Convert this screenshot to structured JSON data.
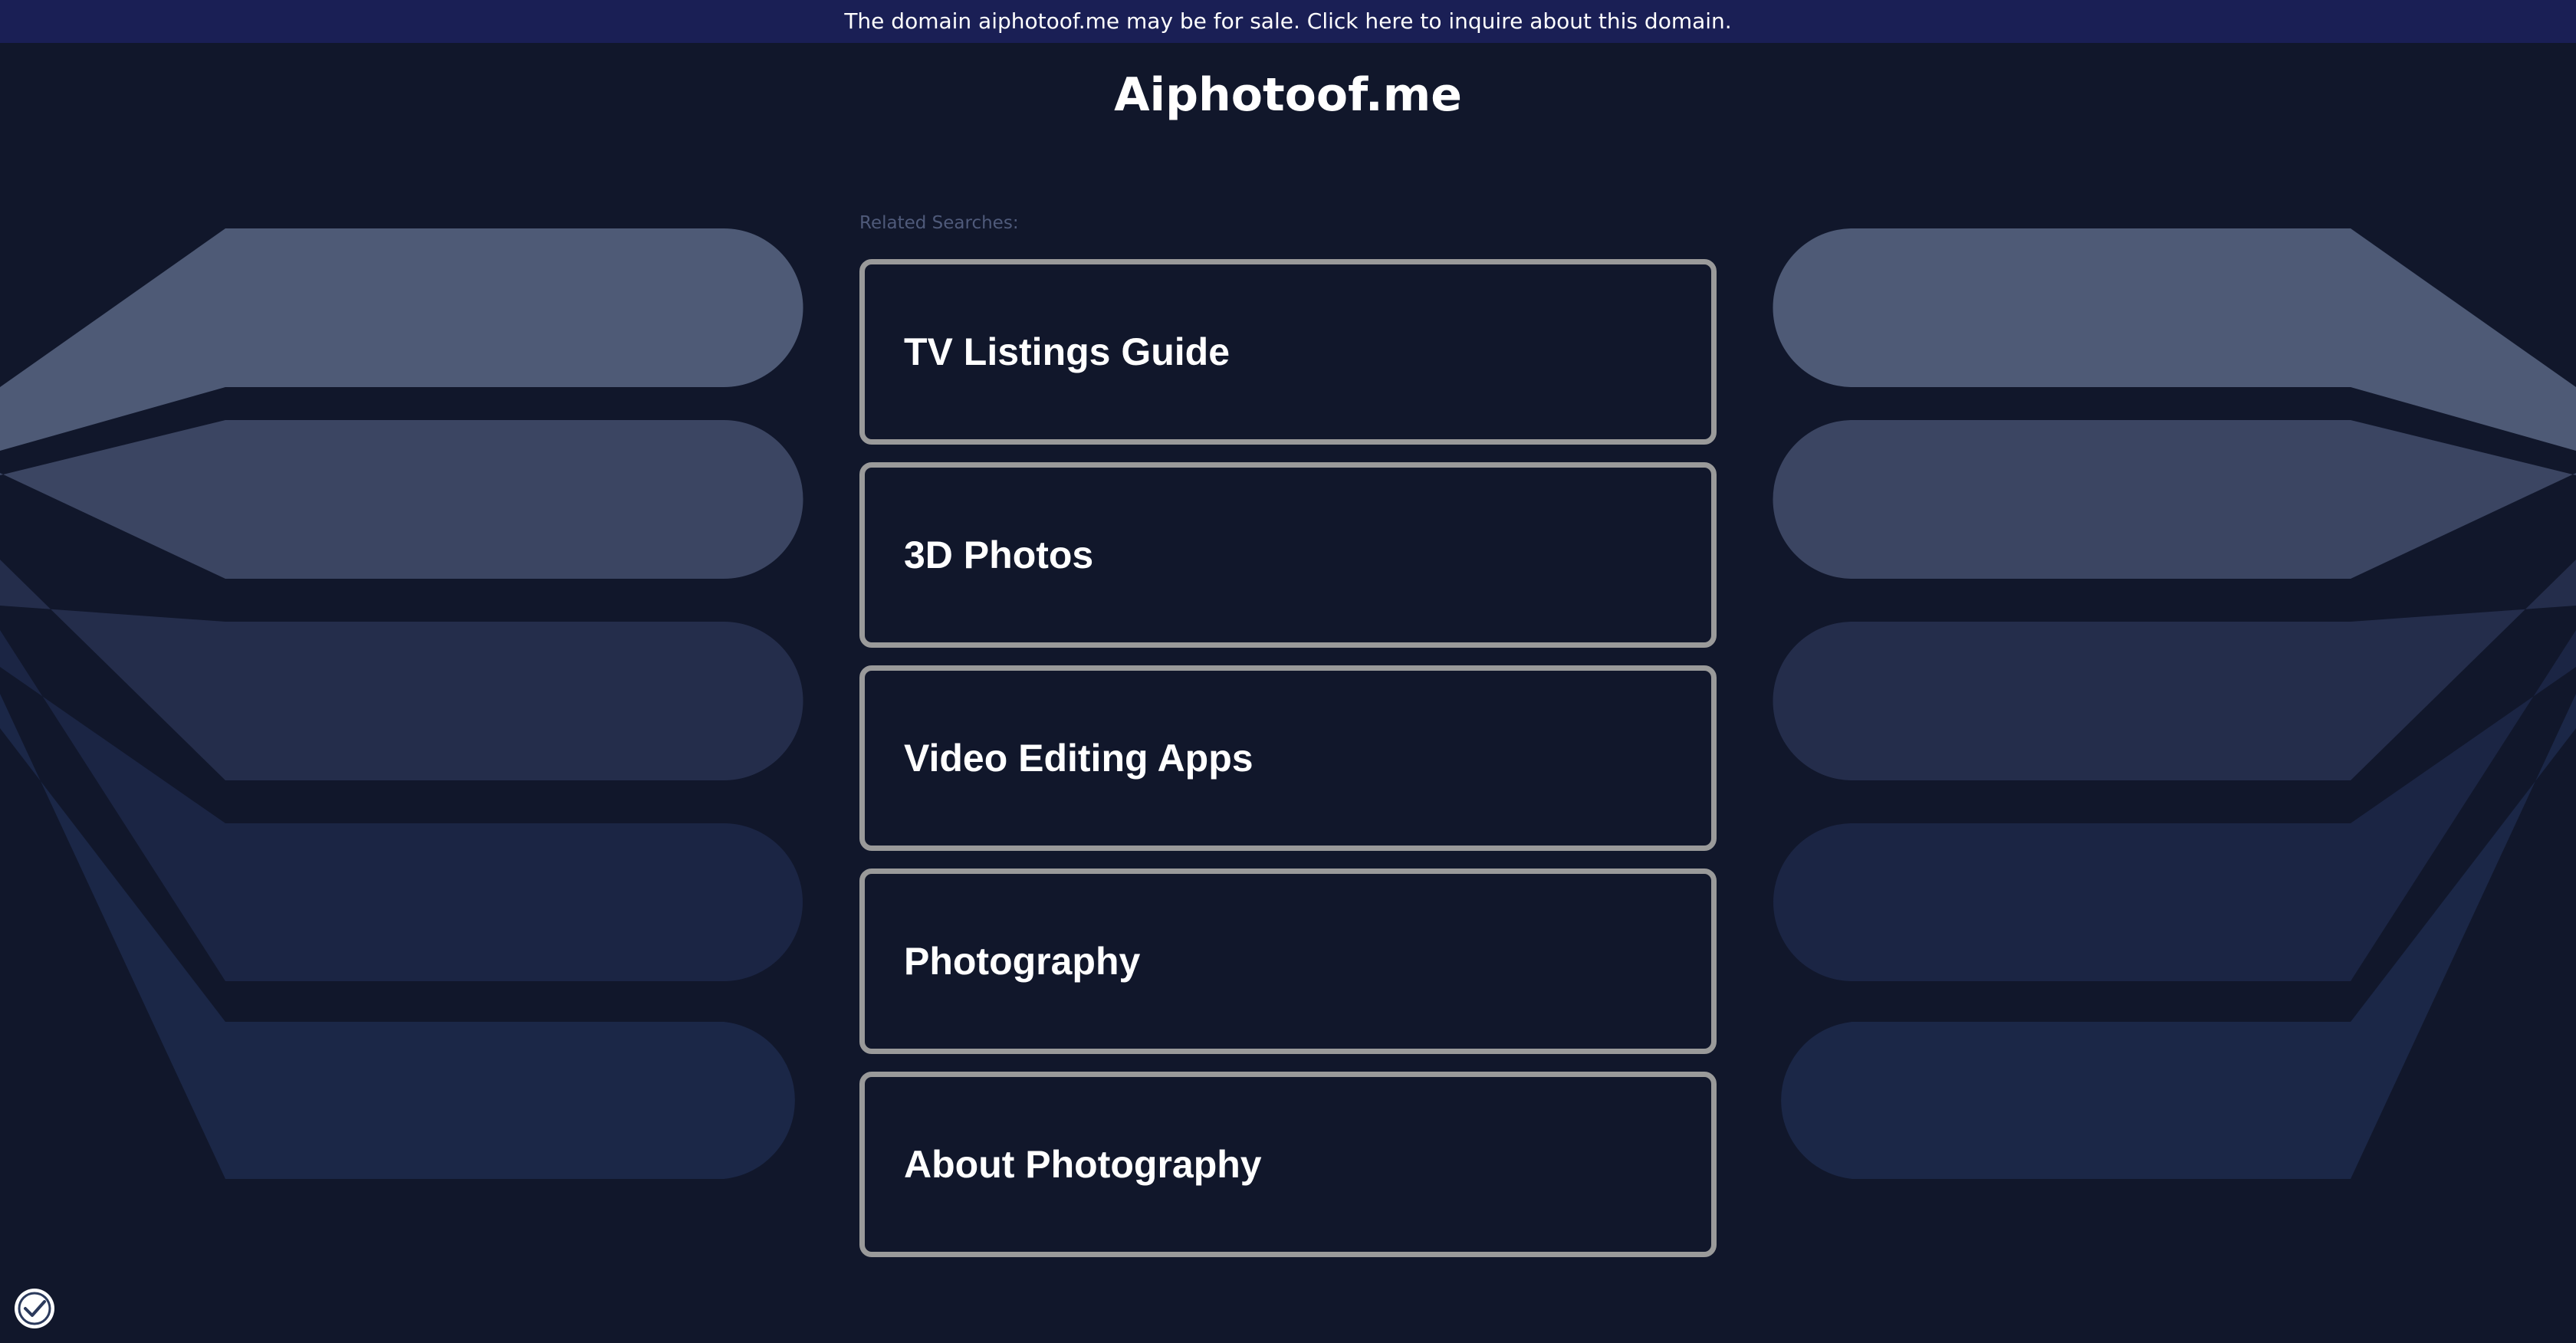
{
  "banner": {
    "text": "The domain aiphotoof.me may be for sale. Click here to inquire about this domain."
  },
  "header": {
    "title": "Aiphotoof.me"
  },
  "related": {
    "label": "Related Searches:",
    "items": [
      {
        "label": "TV Listings Guide"
      },
      {
        "label": "3D Photos"
      },
      {
        "label": "Video Editing Apps"
      },
      {
        "label": "Photography"
      },
      {
        "label": "About Photography"
      }
    ]
  },
  "colors": {
    "background": "#11172b",
    "banner": "#1a1f55",
    "item_border": "#9a9a9a",
    "shape_tones": [
      "#4e5a76",
      "#3b4562",
      "#242d4b",
      "#1b2544",
      "#1b2747"
    ]
  },
  "icons": {
    "privacy": "privacy-shield-check-icon"
  }
}
